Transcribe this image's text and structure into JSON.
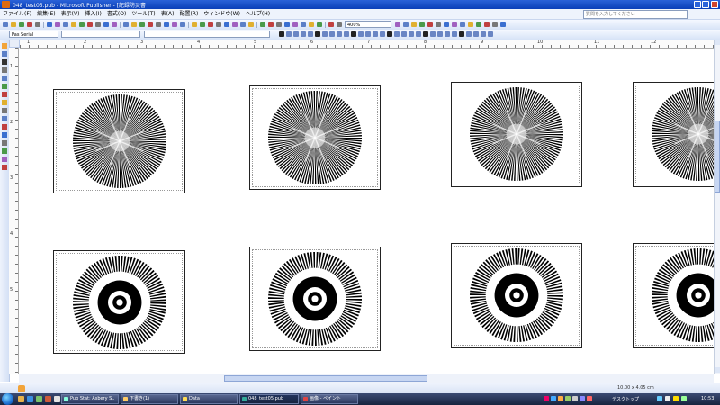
{
  "window": {
    "title": "048_test05.pub - Microsoft Publisher - [記録防災書",
    "help_placeholder": "質問を入力してください"
  },
  "menus": [
    "ファイル(F)",
    "編集(E)",
    "表示(V)",
    "挿入(I)",
    "書式(O)",
    "ツール(T)",
    "表(A)",
    "配置(R)",
    "ウィンドウ(W)",
    "ヘルプ(H)"
  ],
  "toolbar": {
    "zoom": "400%",
    "style": "Normal",
    "font": "Pas Serial",
    "font2": "テキスト"
  },
  "rulers": {
    "h_numbers": [
      "1",
      "2",
      "3",
      "4",
      "5",
      "6",
      "7",
      "8",
      "9",
      "10",
      "11",
      "12"
    ],
    "v_numbers": [
      "1",
      "2",
      "3",
      "4",
      "5"
    ]
  },
  "status": {
    "coords": "10.00 x 4.05 cm"
  },
  "taskbar": {
    "tasks": [
      {
        "label": "Pub Stat: Asbery S.."
      },
      {
        "label": "下書き(1)"
      },
      {
        "label": "Data"
      },
      {
        "label": "048_test05.pub"
      },
      {
        "label": "画像 - ペイント"
      }
    ],
    "tray_text": "デスクトップ",
    "clock": "10:53"
  },
  "pages": [
    {
      "id": "p1",
      "type": "star"
    },
    {
      "id": "p2",
      "type": "star"
    },
    {
      "id": "p3",
      "type": "star"
    },
    {
      "id": "p4",
      "type": "star"
    },
    {
      "id": "p5",
      "type": "ring"
    },
    {
      "id": "p6",
      "type": "ring"
    },
    {
      "id": "p7",
      "type": "ring"
    },
    {
      "id": "p8",
      "type": "ring"
    }
  ]
}
